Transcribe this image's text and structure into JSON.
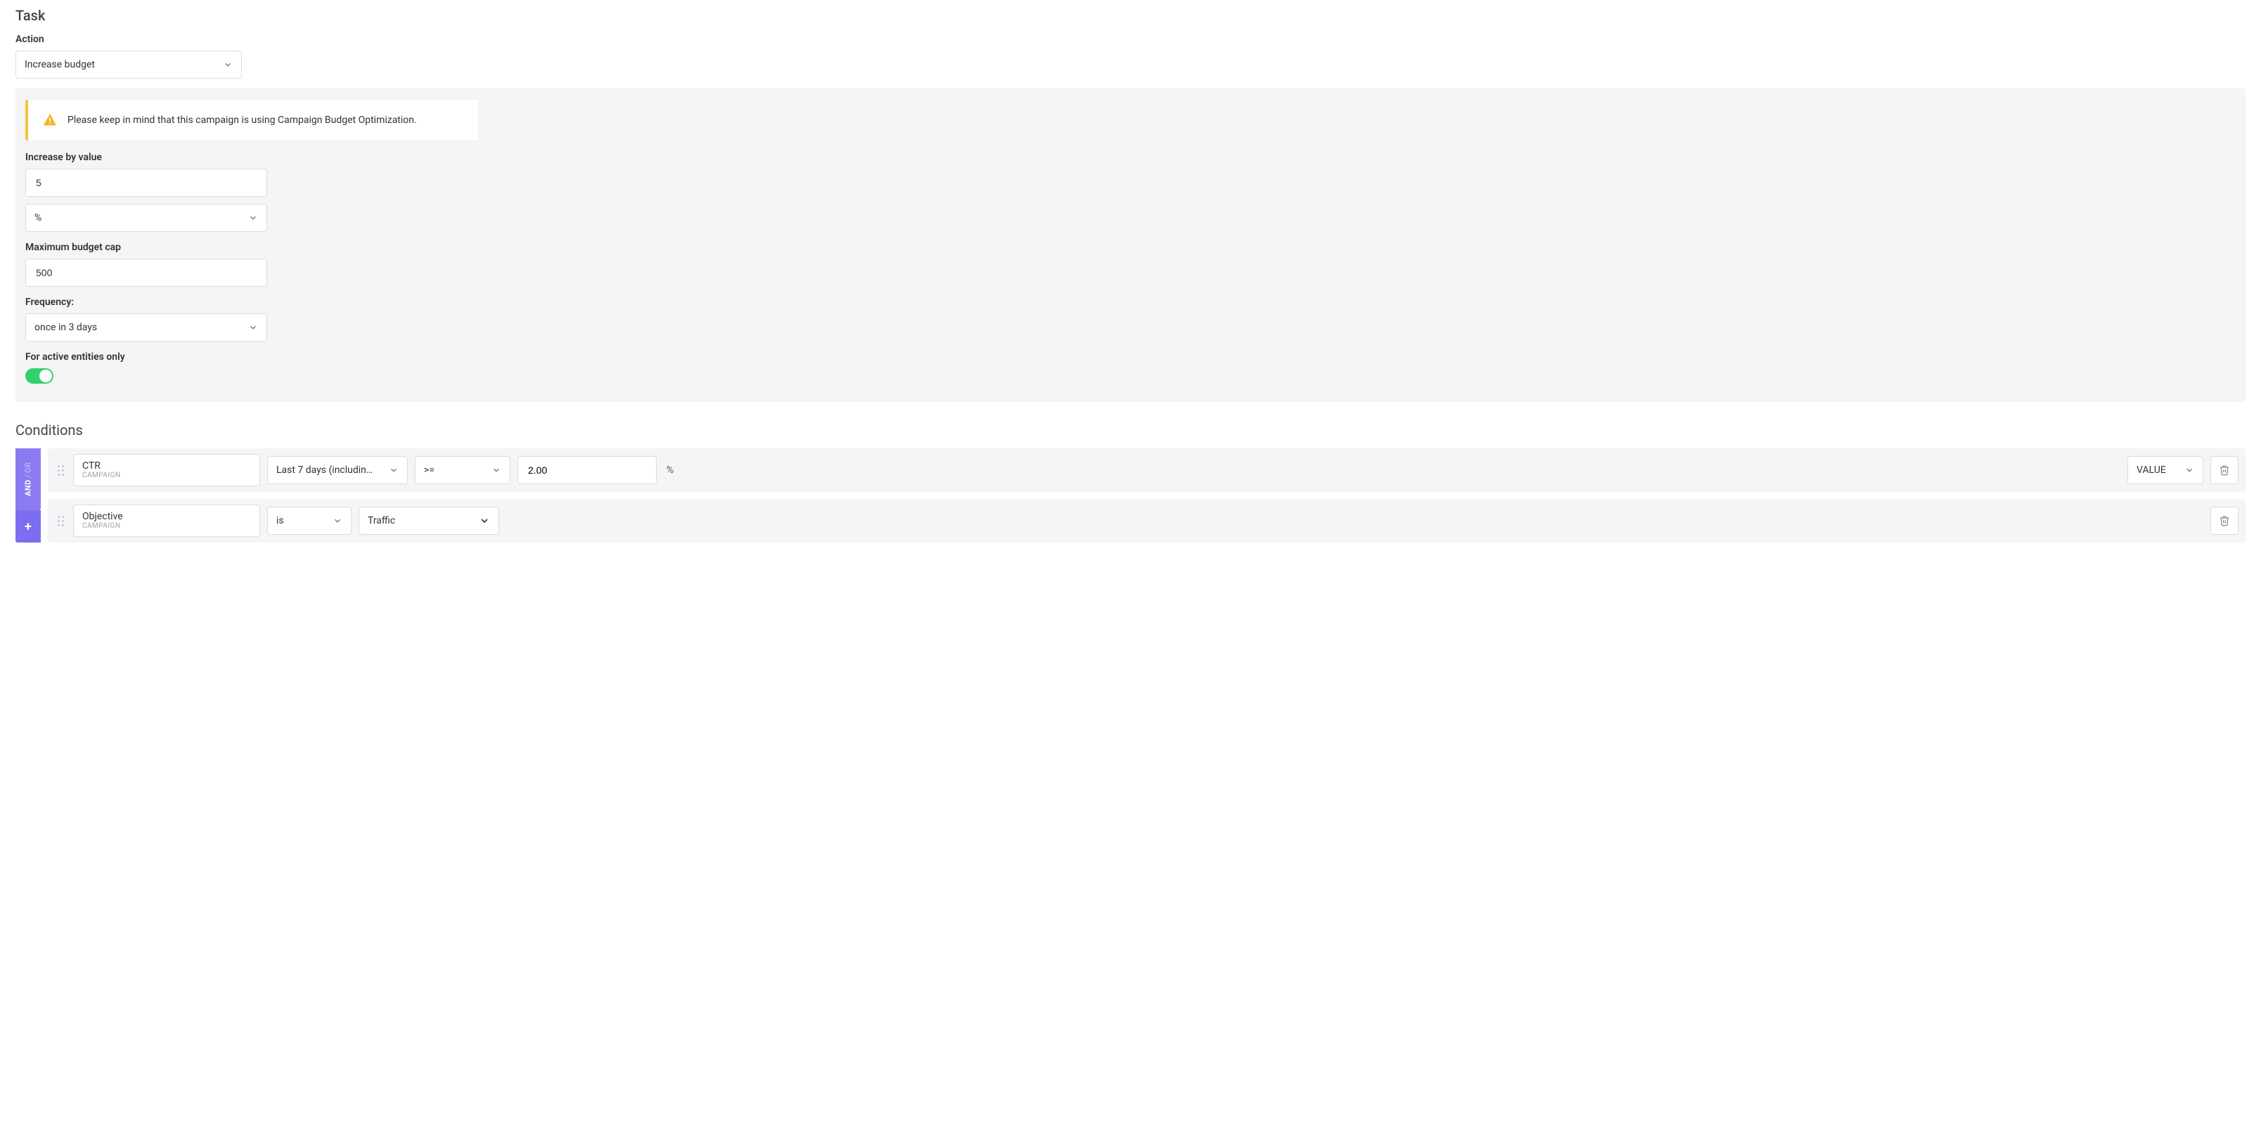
{
  "task": {
    "title": "Task",
    "action_label": "Action",
    "action_value": "Increase budget"
  },
  "panel": {
    "alert_text": "Please keep in mind that this campaign is using Campaign Budget Optimization.",
    "increase_label": "Increase by value",
    "increase_value": "5",
    "increase_unit": "%",
    "cap_label": "Maximum budget cap",
    "cap_value": "500",
    "freq_label": "Frequency:",
    "freq_value": "once in 3 days",
    "active_label": "For active entities only"
  },
  "conditions": {
    "title": "Conditions",
    "rail": {
      "and": "AND",
      "or": "OR",
      "plus": "+"
    },
    "rows": [
      {
        "metric": "CTR",
        "level": "CAMPAIGN",
        "range": "Last 7 days (includin…",
        "op": ">=",
        "value": "2.00",
        "unit": "%",
        "type": "VALUE"
      },
      {
        "metric": "Objective",
        "level": "CAMPAIGN",
        "op": "is",
        "target": "Traffic"
      }
    ]
  }
}
